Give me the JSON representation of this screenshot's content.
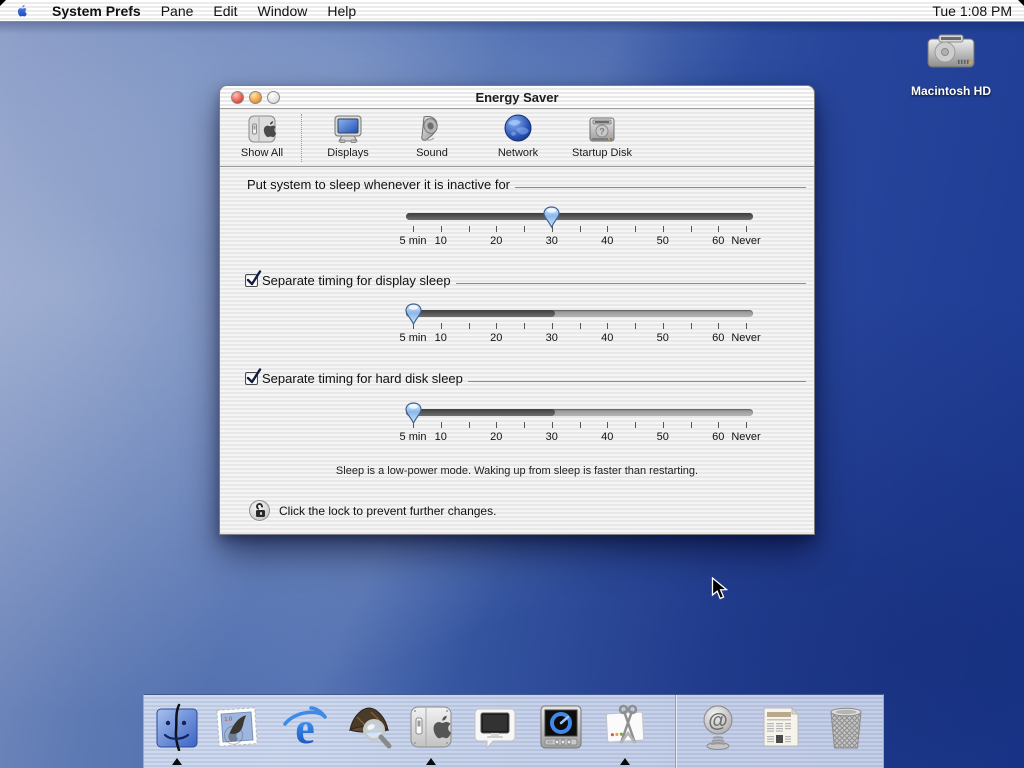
{
  "menu_bar": {
    "app_menu": "System Prefs",
    "items": [
      "Pane",
      "Edit",
      "Window",
      "Help"
    ],
    "clock": "Tue 1:08 PM"
  },
  "window": {
    "title": "Energy Saver",
    "toolbar": {
      "items": [
        {
          "id": "show-all",
          "label": "Show All"
        },
        {
          "id": "displays",
          "label": "Displays"
        },
        {
          "id": "sound",
          "label": "Sound"
        },
        {
          "id": "network",
          "label": "Network"
        },
        {
          "id": "startup-disk",
          "label": "Startup Disk"
        }
      ]
    },
    "slider_scale": {
      "tick_count": 13,
      "labels": [
        {
          "text": "5 min",
          "tick": 0
        },
        {
          "text": "10",
          "tick": 1
        },
        {
          "text": "20",
          "tick": 3
        },
        {
          "text": "30",
          "tick": 5
        },
        {
          "text": "40",
          "tick": 7
        },
        {
          "text": "50",
          "tick": 9
        },
        {
          "text": "60",
          "tick": 11
        },
        {
          "text": "Never",
          "tick": 12
        }
      ]
    },
    "sections": [
      {
        "id": "system-sleep",
        "label": "Put system to sleep whenever it is inactive for",
        "has_checkbox": false,
        "checked": false,
        "slider": {
          "value_index": 5,
          "value_label": "30",
          "active_until_index": 12
        }
      },
      {
        "id": "display-sleep",
        "label": "Separate timing for display sleep",
        "has_checkbox": true,
        "checked": true,
        "slider": {
          "value_index": 0,
          "value_label": "5 min",
          "active_until_index": 5
        }
      },
      {
        "id": "disk-sleep",
        "label": "Separate timing for hard disk sleep",
        "has_checkbox": true,
        "checked": true,
        "slider": {
          "value_index": 0,
          "value_label": "5 min",
          "active_until_index": 5
        }
      }
    ],
    "info_text": "Sleep is a low-power mode. Waking up from sleep is faster than restarting.",
    "lock_text": "Click the lock to prevent further changes."
  },
  "desktop": {
    "icons": [
      {
        "label": "Macintosh HD"
      }
    ]
  },
  "dock": {
    "items": [
      {
        "name": "finder-icon",
        "running": true
      },
      {
        "name": "mail-stamp-icon",
        "running": false
      },
      {
        "name": "internet-explorer-icon",
        "running": false
      },
      {
        "name": "sherlock-icon",
        "running": false
      },
      {
        "name": "system-preferences-icon",
        "running": true
      },
      {
        "name": "displays-dockling-icon",
        "running": false
      },
      {
        "name": "quicktime-player-icon",
        "running": false
      },
      {
        "name": "grab-icon",
        "running": true
      },
      {
        "name": "email-at-spring-icon",
        "running": false
      },
      {
        "name": "news-document-icon",
        "running": false
      },
      {
        "name": "trash-icon",
        "running": false
      }
    ]
  },
  "colors": {
    "desktop_blue": "#2a4da0",
    "slider_thumb_blue": "#5b91dd",
    "dock_tint": "#ccd6ec"
  }
}
